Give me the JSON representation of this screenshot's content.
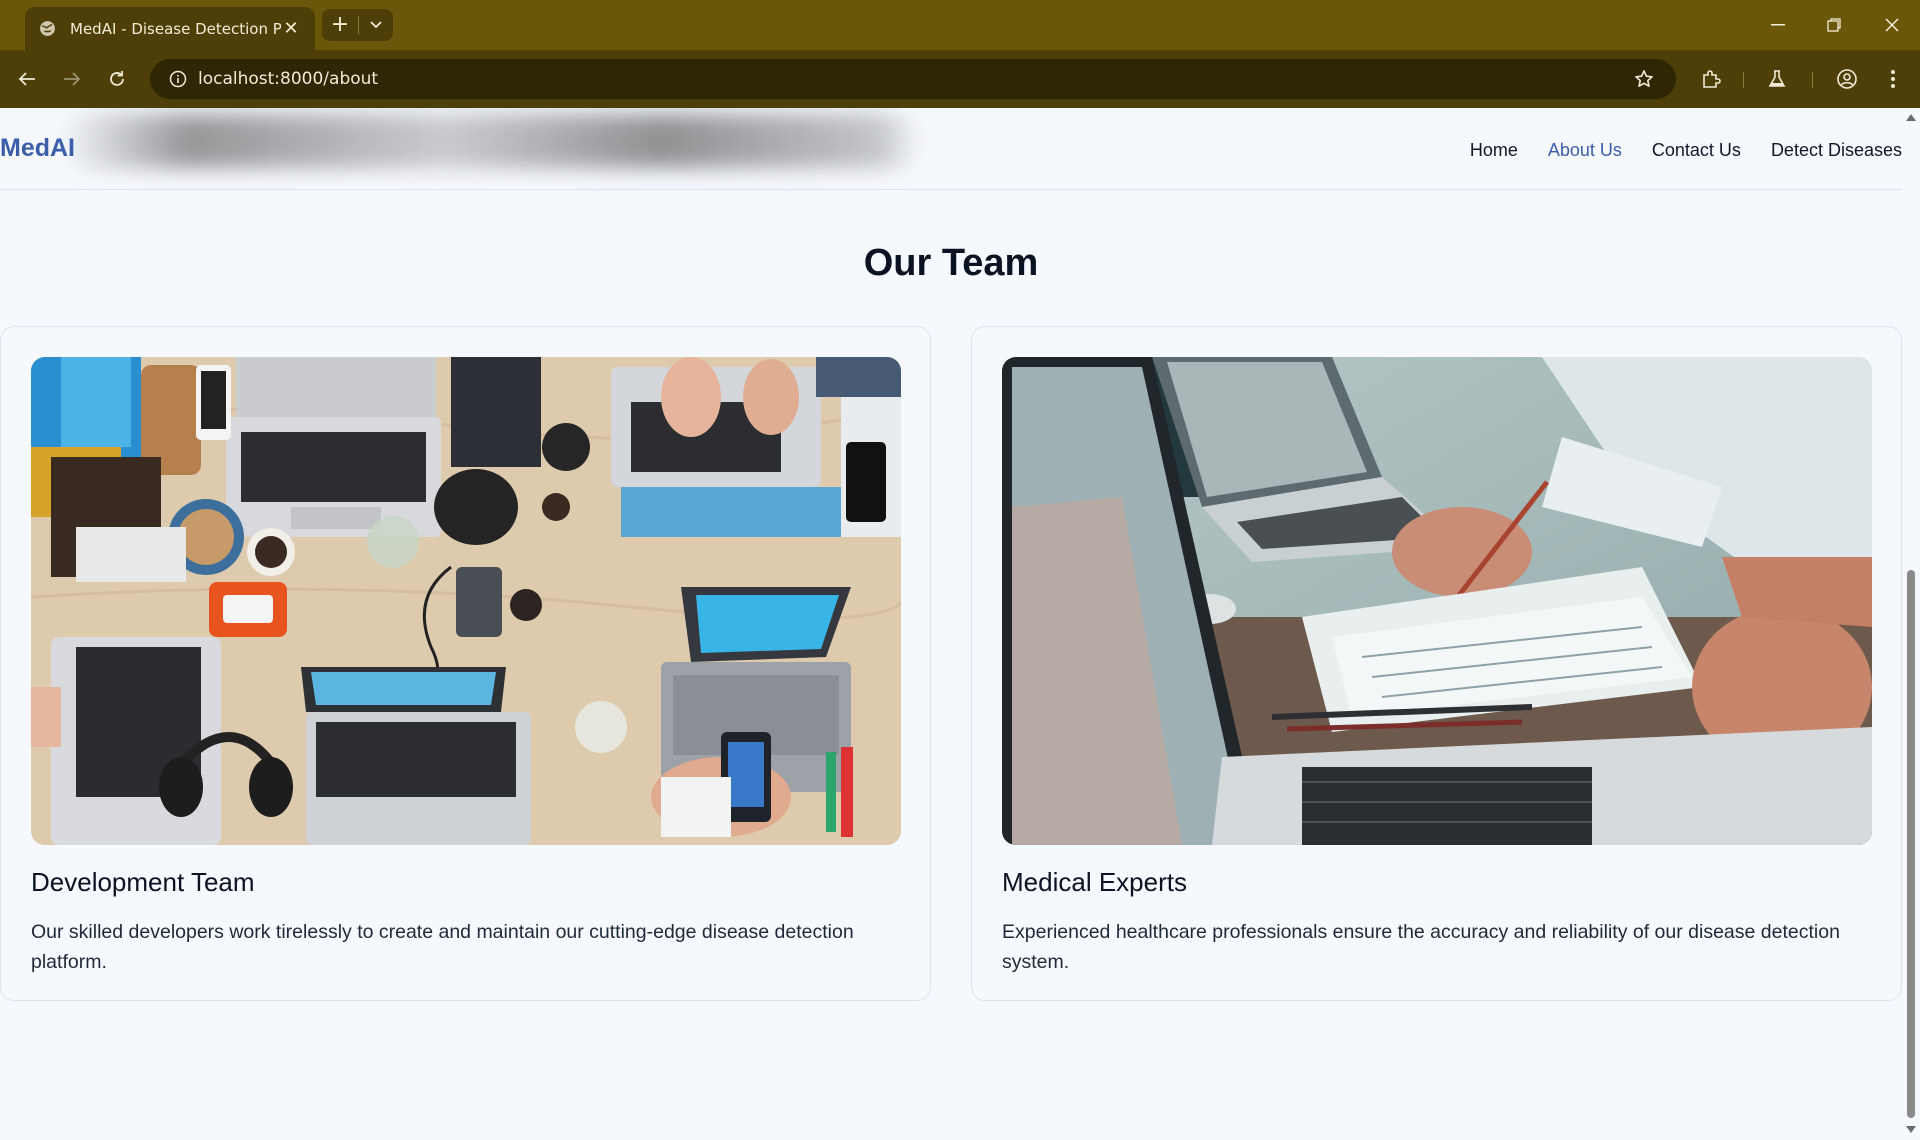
{
  "browser": {
    "tab_title": "MedAI - Disease Detection Plat",
    "url": "localhost:8000/about",
    "icons": [
      "globe-icon",
      "close-icon",
      "plus-icon",
      "chevron-down-icon",
      "back-icon",
      "forward-icon",
      "reload-icon",
      "info-icon",
      "star-icon",
      "puzzle-icon",
      "flask-icon",
      "profile-icon",
      "kebab-icon",
      "minimize-icon",
      "restore-icon",
      "close-window-icon"
    ]
  },
  "header": {
    "brand": "MedAI",
    "nav": [
      "Home",
      "About Us",
      "Contact Us",
      "Detect Diseases"
    ],
    "active_nav": "About Us"
  },
  "team": {
    "title": "Our Team",
    "cards": [
      {
        "name": "Development Team",
        "description": "Our skilled developers work tirelessly to create and maintain our cutting-edge disease detection platform."
      },
      {
        "name": "Medical Experts",
        "description": "Experienced healthcare professionals ensure the accuracy and reliability of our disease detection system."
      }
    ]
  },
  "colors": {
    "chrome_top": "#6b5709",
    "chrome_toolbar": "#4d3f07",
    "brand": "#3b5ea8",
    "page_bg": "#f5f8fd"
  }
}
